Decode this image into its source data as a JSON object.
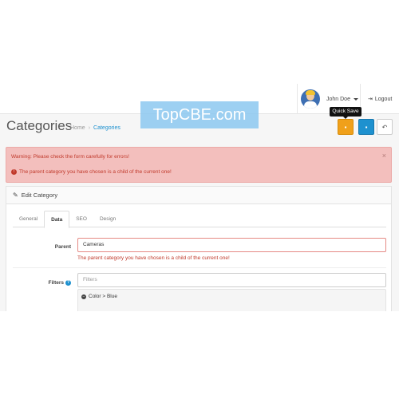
{
  "header": {
    "user_name": "John Doe",
    "logout_label": "Logout"
  },
  "tooltip": {
    "text": "Quick Save"
  },
  "page": {
    "title": "Categories",
    "breadcrumb": {
      "home": "Home",
      "current": "Categories"
    }
  },
  "alert": {
    "warning": "Warning: Please check the form carefully for errors!",
    "error": "The parent category you have chosen is a child of the current one!",
    "close_label": "×"
  },
  "panel": {
    "heading": "Edit Category",
    "tabs": [
      {
        "label": "General",
        "active": false
      },
      {
        "label": "Data",
        "active": true
      },
      {
        "label": "SEO",
        "active": false
      },
      {
        "label": "Design",
        "active": false
      }
    ]
  },
  "form": {
    "parent": {
      "label": "Parent",
      "value": "Cameras",
      "error": "The parent category you have chosen is a child of the current one!"
    },
    "filters": {
      "label": "Filters",
      "placeholder": "Filters",
      "items": [
        "Color > Blue"
      ]
    }
  },
  "watermark": {
    "text": "TopCBE.com"
  },
  "colors": {
    "primary": "#1e91cf",
    "warning": "#f0a01a",
    "danger": "#c0392b",
    "alert_bg": "#f3bfbd"
  },
  "icons": {
    "quick_save": "save-icon",
    "save": "save-icon",
    "back": "reply-icon",
    "logout": "sign-out-icon",
    "edit": "pencil-icon",
    "help": "question-circle-icon",
    "remove_filter": "minus-circle-icon"
  }
}
